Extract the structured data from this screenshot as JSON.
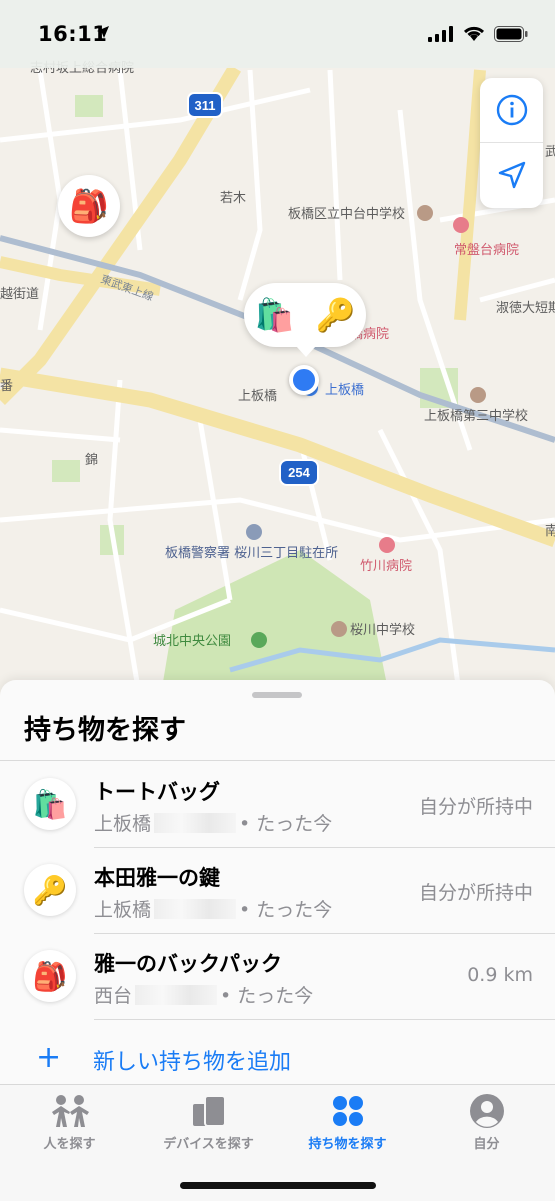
{
  "status_bar": {
    "time": "16:11"
  },
  "map": {
    "labels": {
      "wakagi": "若木",
      "school_nakadai": "板橋区立中台中学校",
      "tokiwadai_hospital": "常盤台病院",
      "shukutoku": "淑徳大短期",
      "tobu_line": "東武東上線",
      "kawagoe_kaido": "越街道",
      "hospital_partial": "橋病院",
      "kamiitabashi_area": "上板橋",
      "kamiitabashi_station": "上板橋",
      "school_daisan": "上板橋第三中学校",
      "nishiki": "錦",
      "police": "板橋警察署 桜川三丁目駐在所",
      "takekawa_hospital": "竹川病院",
      "park": "城北中央公園",
      "sakuragawa_school": "桜川中学校",
      "top_partial": "志村坂上総合病院",
      "right_edge_top": "武",
      "right_edge_mid": "南",
      "left_edge": "番",
      "route_311": "311",
      "route_254": "254"
    },
    "pins": {
      "backpack_icon": "🎒",
      "tote_icon": "🛍️",
      "key_icon": "🔑"
    }
  },
  "sheet": {
    "title": "持ち物を探す",
    "items": [
      {
        "icon": "🛍️",
        "name": "トートバッグ",
        "location": "上板橋",
        "time": "• たった今",
        "status": "自分が所持中"
      },
      {
        "icon": "🔑",
        "name": "本田雅一の鍵",
        "location": "上板橋",
        "time": "• たった今",
        "status": "自分が所持中"
      },
      {
        "icon": "🎒",
        "name": "雅一のバックパック",
        "location": "西台",
        "time": "• たった今",
        "status": "0.9 km"
      }
    ],
    "add_label": "新しい持ち物を追加",
    "add_symbol": "+"
  },
  "tabs": [
    {
      "label": "人を探す",
      "icon": "people-icon"
    },
    {
      "label": "デバイスを探す",
      "icon": "devices-icon"
    },
    {
      "label": "持ち物を探す",
      "icon": "items-icon",
      "active": true
    },
    {
      "label": "自分",
      "icon": "me-icon"
    }
  ],
  "colors": {
    "accent": "#1a7cf5",
    "map_bg": "#f4f1ec",
    "road_yellow": "#f7e6a6",
    "park_green": "#cde5b3",
    "rail": "#b9c6d6"
  }
}
